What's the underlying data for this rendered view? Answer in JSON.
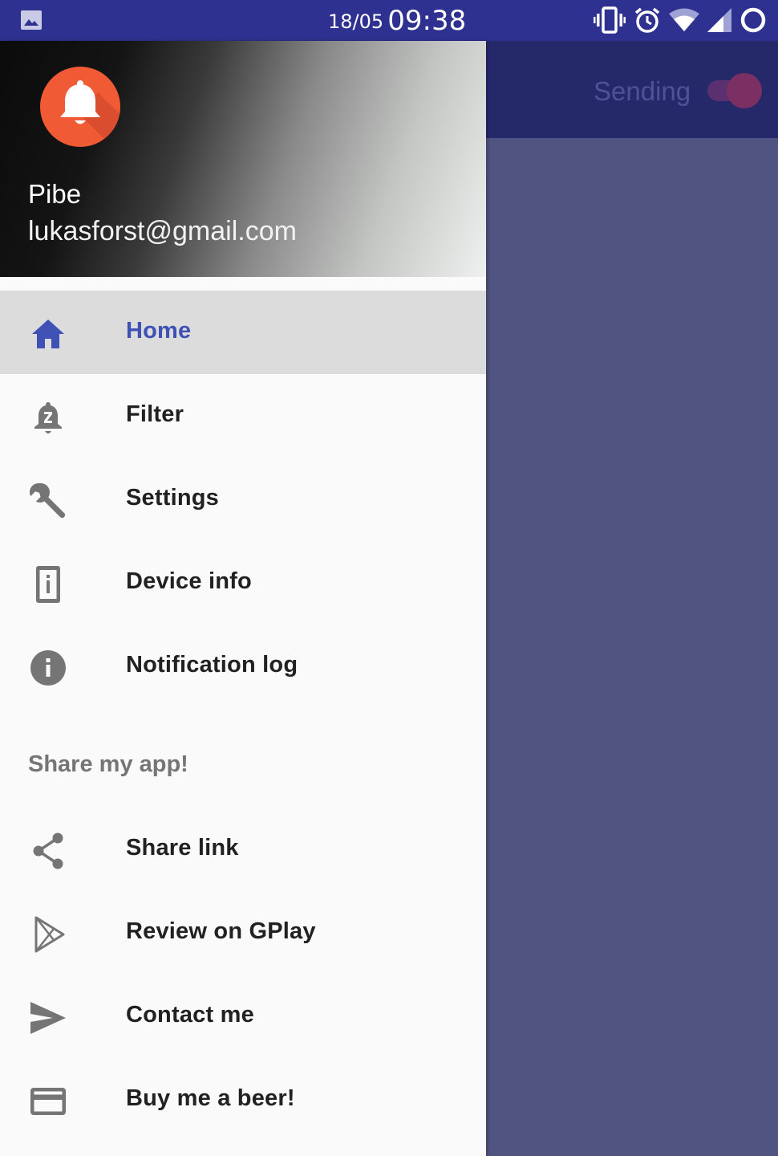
{
  "status_bar": {
    "date": "18/05",
    "time": "09:38",
    "icons": [
      "gallery-icon",
      "vibrate-icon",
      "alarm-icon",
      "wifi-icon",
      "signal-icon",
      "sync-circle-icon"
    ]
  },
  "app_bar": {
    "toggle_label": "Sending",
    "toggle_on": true
  },
  "drawer": {
    "header": {
      "user_name": "Pibe",
      "user_email": "lukasforst@gmail.com",
      "avatar_icon": "bell-icon"
    },
    "items": [
      {
        "label": "Home",
        "icon": "home-icon",
        "active": true
      },
      {
        "label": "Filter",
        "icon": "snooze-bell-icon",
        "active": false
      },
      {
        "label": "Settings",
        "icon": "wrench-icon",
        "active": false
      },
      {
        "label": "Device info",
        "icon": "device-info-icon",
        "active": false
      },
      {
        "label": "Notification log",
        "icon": "info-icon",
        "active": false
      }
    ],
    "section_title": "Share my app!",
    "share_items": [
      {
        "label": "Share link",
        "icon": "share-icon"
      },
      {
        "label": "Review on GPlay",
        "icon": "play-store-icon"
      },
      {
        "label": "Contact me",
        "icon": "send-icon"
      },
      {
        "label": "Buy me a beer!",
        "icon": "credit-card-icon"
      }
    ]
  },
  "colors": {
    "status_bar": "#2e3190",
    "app_bar": "#25296a",
    "content_scrim": "#515480",
    "accent": "#3f51b5",
    "avatar": "#f05a35",
    "icon_gray": "#757575"
  }
}
